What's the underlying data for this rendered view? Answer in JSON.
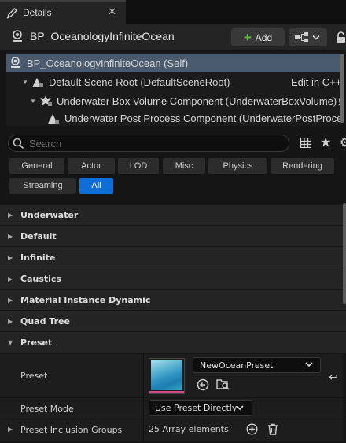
{
  "tab": {
    "title": "Details",
    "close_glyph": "✕"
  },
  "header": {
    "blueprint_name": "BP_OceanologyInfiniteOcean",
    "add_label": "Add",
    "add_icon": "plus-icon"
  },
  "tree": {
    "rows": [
      {
        "label": "BP_OceanologyInfiniteOcean (Self)",
        "selected": true
      },
      {
        "label": "Default Scene Root (DefaultSceneRoot)",
        "action": "Edit in C++"
      },
      {
        "label": "Underwater Box Volume Component (UnderwaterBoxVolume)",
        "suffix": "!"
      },
      {
        "label": "Underwater Post Process Component (UnderwaterPostProce"
      }
    ]
  },
  "search": {
    "placeholder": "Search"
  },
  "filters": {
    "chips": [
      "General",
      "Actor",
      "LOD",
      "Misc",
      "Physics",
      "Rendering",
      "Streaming",
      "All"
    ],
    "active": "All"
  },
  "categories": [
    {
      "label": "Underwater",
      "expanded": false
    },
    {
      "label": "Default",
      "expanded": false
    },
    {
      "label": "Infinite",
      "expanded": false
    },
    {
      "label": "Caustics",
      "expanded": false
    },
    {
      "label": "Material Instance Dynamic",
      "expanded": false
    },
    {
      "label": "Quad Tree",
      "expanded": false
    },
    {
      "label": "Preset",
      "expanded": true
    }
  ],
  "preset_section": {
    "preset_label": "Preset",
    "preset_value": "NewOceanPreset",
    "mode_label": "Preset Mode",
    "mode_value": "Use Preset Directly",
    "inclusion_label": "Preset Inclusion Groups",
    "inclusion_value": "25 Array elements"
  },
  "colors": {
    "accent": "#0e6ed8",
    "selection": "#4a5a6e",
    "add_plus": "#5fbf3a"
  }
}
